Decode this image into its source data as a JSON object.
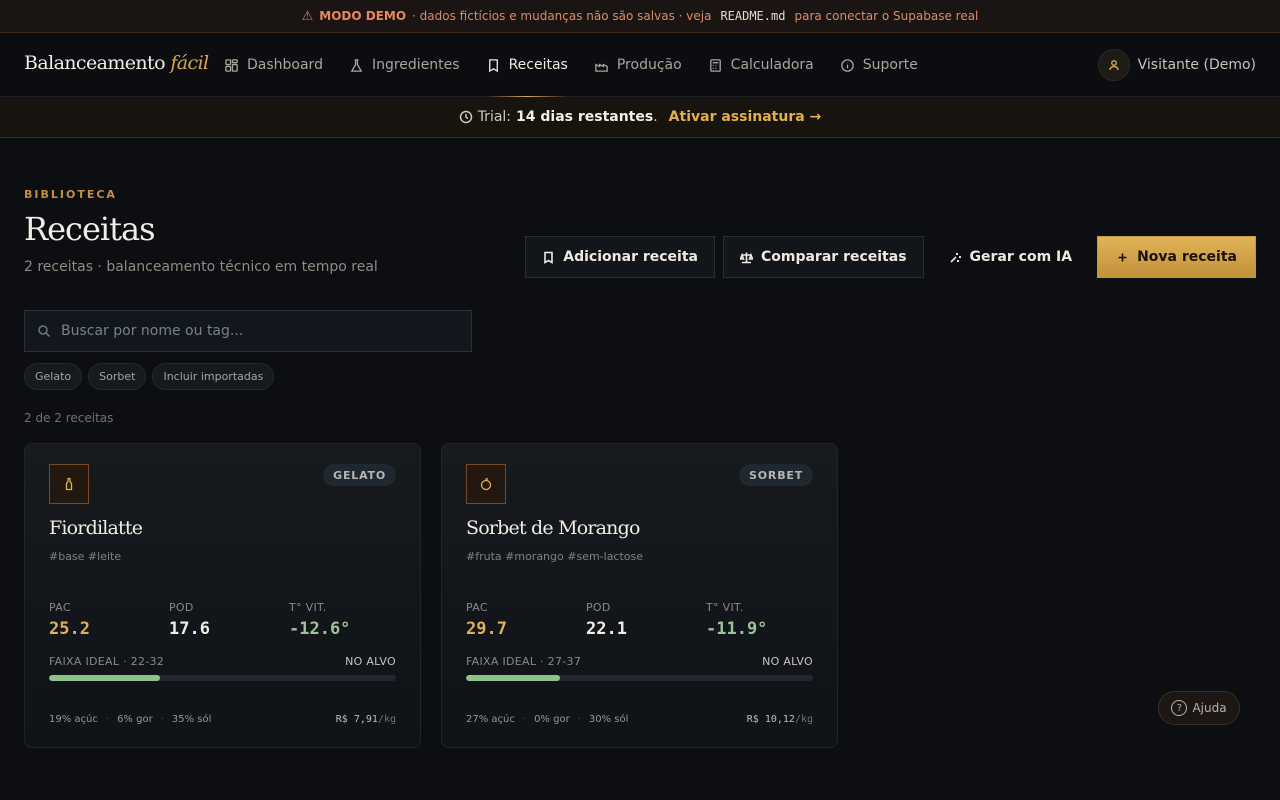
{
  "demo_bar": {
    "label": "MODO DEMO",
    "text_before": "· dados fictícios e mudanças não são salvas · veja",
    "code": "README.md",
    "text_after": "para conectar o Supabase real"
  },
  "nav": {
    "brand_main": "Balanceamento",
    "brand_accent": "fácil",
    "items": [
      {
        "label": "Dashboard",
        "icon": "grid-icon"
      },
      {
        "label": "Ingredientes",
        "icon": "flask-icon"
      },
      {
        "label": "Receitas",
        "icon": "book-icon",
        "active": true
      },
      {
        "label": "Produção",
        "icon": "factory-icon"
      },
      {
        "label": "Calculadora",
        "icon": "calculator-icon"
      },
      {
        "label": "Suporte",
        "icon": "info-icon"
      }
    ],
    "user": "Visitante (Demo)"
  },
  "trial": {
    "prefix": "Trial:",
    "days": "14 dias restantes",
    "period": ".",
    "cta": "Ativar assinatura →"
  },
  "page": {
    "eyebrow": "BIBLIOTECA",
    "title": "Receitas",
    "subtitle": "2 receitas · balanceamento técnico em tempo real"
  },
  "actions": {
    "add": "Adicionar receita",
    "compare": "Comparar receitas",
    "ai": "Gerar com IA",
    "new": "Nova receita"
  },
  "search": {
    "placeholder": "Buscar por nome ou tag..."
  },
  "filters": [
    "Gelato",
    "Sorbet",
    "Incluir importadas"
  ],
  "count": "2 de 2 receitas",
  "recipes": [
    {
      "name": "Fiordilatte",
      "type": "GELATO",
      "icon": "bottle-icon",
      "tags": "#base #leite",
      "pac_label": "PAC",
      "pac": "25.2",
      "pod_label": "POD",
      "pod": "17.6",
      "tvit_label": "T° VIT.",
      "tvit": "-12.6°",
      "range_label": "FAIXA IDEAL · 22-32",
      "status": "NO ALVO",
      "progress": 0.32,
      "sugar": "19% açúc",
      "fat": "6% gor",
      "solids": "35% sól",
      "price": "R$ 7,91",
      "price_unit": "/kg"
    },
    {
      "name": "Sorbet de Morango",
      "type": "SORBET",
      "icon": "fruit-icon",
      "tags": "#fruta #morango #sem-lactose",
      "pac_label": "PAC",
      "pac": "29.7",
      "pod_label": "POD",
      "pod": "22.1",
      "tvit_label": "T° VIT.",
      "tvit": "-11.9°",
      "range_label": "FAIXA IDEAL · 27-37",
      "status": "NO ALVO",
      "progress": 0.27,
      "sugar": "27% açúc",
      "fat": "0% gor",
      "solids": "30% sól",
      "price": "R$ 10,12",
      "price_unit": "/kg"
    }
  ],
  "help": "Ajuda"
}
